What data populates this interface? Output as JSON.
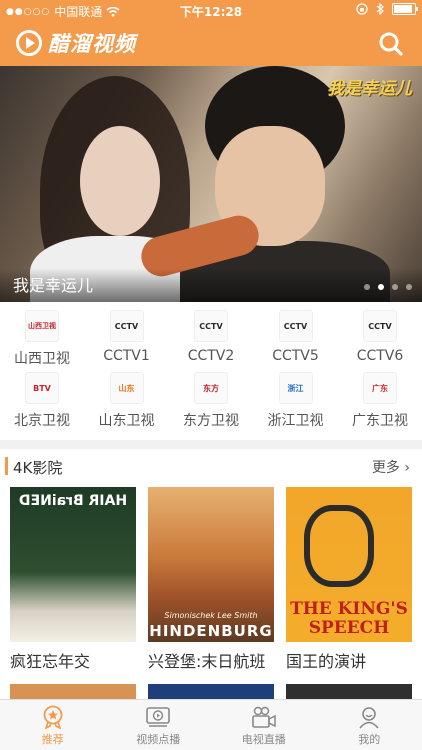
{
  "status_bar": {
    "carrier": "中国联通",
    "time": "下午12:28"
  },
  "app": {
    "name": "醋溜视频",
    "accent": "#f39a4b"
  },
  "banner": {
    "title": "我是幸运儿",
    "badge": "我是幸运儿",
    "slides": 4,
    "active_slide": 2
  },
  "channels": [
    {
      "name": "山西卫视",
      "logo": "山西卫视"
    },
    {
      "name": "CCTV1",
      "logo": "CCTV"
    },
    {
      "name": "CCTV2",
      "logo": "CCTV"
    },
    {
      "name": "CCTV5",
      "logo": "CCTV"
    },
    {
      "name": "CCTV6",
      "logo": "CCTV"
    },
    {
      "name": "北京卫视",
      "logo": "BTV"
    },
    {
      "name": "山东卫视",
      "logo": "山东"
    },
    {
      "name": "东方卫视",
      "logo": "东方"
    },
    {
      "name": "浙江卫视",
      "logo": "浙江"
    },
    {
      "name": "广东卫视",
      "logo": "广东"
    }
  ],
  "section": {
    "title": "4K影院",
    "more": "更多 ›"
  },
  "movies": [
    {
      "title": "疯狂忘年交",
      "poster_text": "HAIR BraiNED"
    },
    {
      "title": "兴登堡:末日航班",
      "poster_text": "HINDENBURG",
      "poster_sub": "Simonischek   Lee Smith"
    },
    {
      "title": "国王的演讲",
      "poster_text": "THE KING'S SPEECH"
    }
  ],
  "tabs": [
    {
      "label": "推荐",
      "icon": "star-medal-icon",
      "active": true
    },
    {
      "label": "视频点播",
      "icon": "video-play-icon",
      "active": false
    },
    {
      "label": "电视直播",
      "icon": "video-camera-icon",
      "active": false
    },
    {
      "label": "我的",
      "icon": "user-profile-icon",
      "active": false
    }
  ]
}
